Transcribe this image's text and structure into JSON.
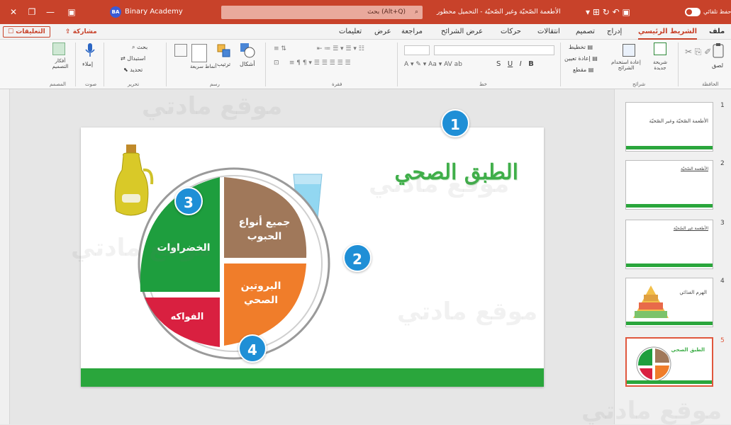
{
  "titlebar": {
    "autosave": "حفظ تلقائي",
    "account": "Binary Academy",
    "avatar_initials": "BA",
    "search_placeholder": "بحث (Alt+Q)",
    "doc_title": "الأطعمة الصّحيّة وغير الصّحيّة - التحميل محظور"
  },
  "tabs": {
    "file": "ملف",
    "home": "الشريط الرئيسي",
    "insert": "إدراج",
    "design": "تصميم",
    "transitions": "انتقالات",
    "animations": "حركات",
    "slideshow": "عرض الشرائح",
    "review": "مراجعة",
    "view": "عرض",
    "help": "تعليمات",
    "share": "مشاركة",
    "comments": "التعليقات"
  },
  "ribbon": {
    "clipboard": {
      "paste": "لصق",
      "group": "الحافظة"
    },
    "slides": {
      "new_slide": "شريحة جديدة",
      "reuse": "إعادة استخدام الشرائح",
      "layout": "تخطيط",
      "reset": "إعادة تعيين",
      "section": "مقطع",
      "group": "شرائح"
    },
    "font": {
      "group": "خط",
      "bold": "B",
      "italic": "I",
      "underline": "U",
      "strike": "S"
    },
    "paragraph": {
      "group": "فقرة"
    },
    "drawing": {
      "shapes": "أشكال",
      "arrange": "ترتيب",
      "styles": "أنماط سريعة",
      "group": "رسم"
    },
    "editing": {
      "find": "بحث",
      "replace": "استبدال",
      "select": "تحديد",
      "group": "تحرير"
    },
    "voice": {
      "dictate": "إملاء",
      "group": "صوت"
    },
    "designer": {
      "ideas": "أفكار التصميم",
      "group": "المصمم"
    }
  },
  "slide": {
    "title": "الطبق الصحي",
    "plate": {
      "vegetables": "الخضراوات",
      "grains": "جميع أنواع الحبوب",
      "fruits": "الفواكه",
      "protein": "البروتين الصحي"
    },
    "colors": {
      "vegetables": "#1e9e3e",
      "grains": "#a0785a",
      "fruits": "#d92040",
      "protein": "#f07d2a",
      "band": "#2aa63c"
    }
  },
  "callouts": [
    "1",
    "2",
    "3",
    "4"
  ],
  "thumbnails": [
    {
      "num": "1",
      "title": "الأطعمة الصّحيّة وغير الصّحيّة"
    },
    {
      "num": "2",
      "title": "الأطعمة الصّحيّة"
    },
    {
      "num": "3",
      "title": "الأطعمة غير الصّحيّة"
    },
    {
      "num": "4",
      "title": "الهرم الغذائي"
    },
    {
      "num": "5",
      "title": "الطبق الصحي"
    }
  ],
  "watermark": "موقع مادتي"
}
